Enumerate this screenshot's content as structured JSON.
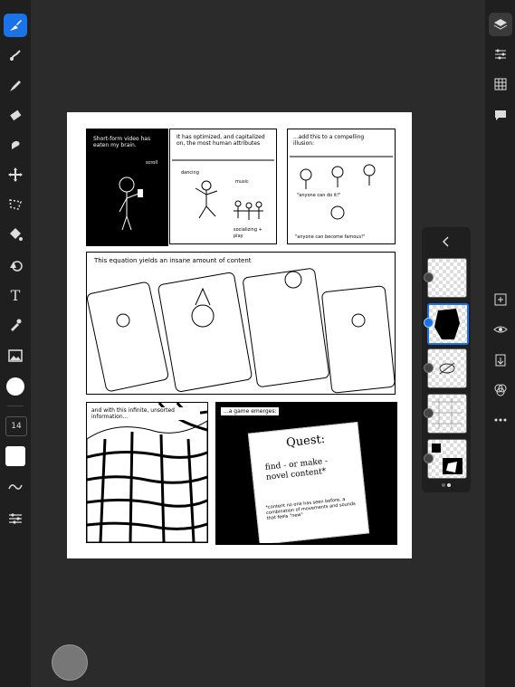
{
  "toolbar": {
    "brush_size": "14"
  },
  "comic": {
    "panel1": "Short-form video has eaten my brain.",
    "panel1_sfx": "scroll",
    "panel2": "It has optimized, and capitalized on, the most human attributes",
    "panel2_words": [
      "dancing",
      "music",
      "socializing + play"
    ],
    "panel3": "...add this to a compelling illusion:",
    "panel3_quote1": "\"anyone can do it!\"",
    "panel3_quote2": "\"anyone can become famous!\"",
    "panel4": "This equation yields an insane amount of content",
    "panel5": "and with this infinite, unsorted information...",
    "panel6": "...a game emerges:",
    "scroll_title": "Quest:",
    "scroll_sub": "find - or make - novel content*",
    "scroll_note": "*content no one has seen before, a combination of movements and sounds that feels \"new\""
  },
  "layers": {
    "count": 5,
    "selected_index": 1,
    "page_dots": 2
  },
  "colors": {
    "accent": "#1a73e8",
    "toolbar_bg": "#1f1f1f",
    "workspace_bg": "#2b2b2b",
    "paper": "#ffffff",
    "ink": "#000000"
  }
}
